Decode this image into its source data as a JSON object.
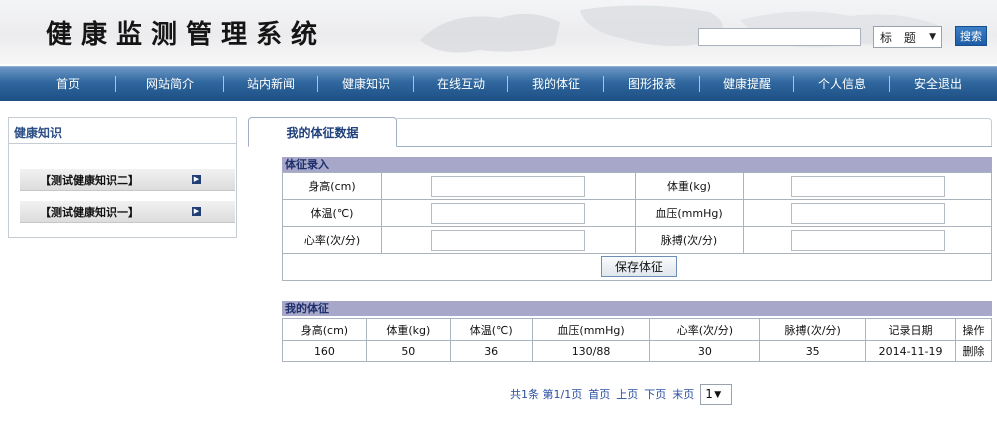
{
  "header": {
    "title": "健康监测管理系统",
    "search": {
      "input_value": "",
      "select_value": "标 题",
      "button_label": "搜索"
    }
  },
  "nav": {
    "items": [
      "首页",
      "网站简介",
      "站内新闻",
      "健康知识",
      "在线互动",
      "我的体征",
      "图形报表",
      "健康提醒",
      "个人信息",
      "安全退出"
    ]
  },
  "sidebar": {
    "title": "健康知识",
    "items": [
      "【测试健康知识二】",
      "【测试健康知识一】"
    ]
  },
  "tab": {
    "label": "我的体征数据"
  },
  "entry_form": {
    "section_title": "体征录入",
    "rows": [
      {
        "left_label": "身高(cm)",
        "right_label": "体重(kg)"
      },
      {
        "left_label": "体温(℃)",
        "right_label": "血压(mmHg)"
      },
      {
        "left_label": "心率(次/分)",
        "right_label": "脉搏(次/分)"
      }
    ],
    "save_label": "保存体征"
  },
  "records": {
    "section_title": "我的体征",
    "columns": [
      "身高(cm)",
      "体重(kg)",
      "体温(℃)",
      "血压(mmHg)",
      "心率(次/分)",
      "脉搏(次/分)",
      "记录日期",
      "操作"
    ],
    "rows": [
      [
        "160",
        "50",
        "36",
        "130/88",
        "30",
        "35",
        "2014-11-19",
        "删除"
      ]
    ]
  },
  "pager": {
    "summary": "共1条 第1/1页",
    "first": "首页",
    "prev": "上页",
    "next": "下页",
    "last": "末页",
    "page_value": "1"
  },
  "colors": {
    "nav_blue": "#2f679e",
    "section_header": "#a6a7c9",
    "link_blue": "#2a4fa0",
    "search_button": "#1d5ca5"
  }
}
